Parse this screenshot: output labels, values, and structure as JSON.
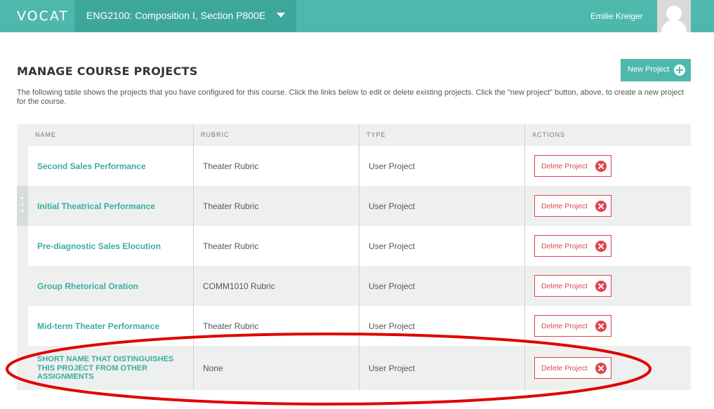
{
  "header": {
    "logo": "VOCAT",
    "course": "ENG2100: Composition I, Section P800E",
    "user_name": "Emilie Kreiger"
  },
  "page": {
    "title": "MANAGE COURSE PROJECTS",
    "new_project_label": "New Project",
    "intro": "The following table shows the projects that you have configured for this course. Click the links below to edit or delete existing projects. Click the \"new project\" button, above, to create a new project for the course."
  },
  "table": {
    "columns": [
      "NAME",
      "RUBRIC",
      "TYPE",
      "ACTIONS"
    ],
    "rows": [
      {
        "name": "Second Sales Performance",
        "rubric": "Theater Rubric",
        "type": "User Project",
        "action": "Delete Project"
      },
      {
        "name": "Initial Theatrical Performance",
        "rubric": "Theater Rubric",
        "type": "User Project",
        "action": "Delete Project"
      },
      {
        "name": "Pre-diagnostic Sales Elocution",
        "rubric": "Theater Rubric",
        "type": "User Project",
        "action": "Delete Project"
      },
      {
        "name": "Group Rhetorical Oration",
        "rubric": "COMM1010 Rubric",
        "type": "User Project",
        "action": "Delete Project"
      },
      {
        "name": "Mid-term Theater Performance",
        "rubric": "Theater Rubric",
        "type": "User Project",
        "action": "Delete Project"
      },
      {
        "name": "SHORT NAME THAT DISTINGUISHES THIS PROJECT FROM OTHER ASSIGNMENTS",
        "rubric": "None",
        "type": "User Project",
        "action": "Delete Project"
      }
    ]
  },
  "colors": {
    "brand": "#4fb8ad",
    "brand_dark": "#3ea79c",
    "link": "#3aada1",
    "danger": "#e0434e",
    "annotation": "#e00000"
  }
}
